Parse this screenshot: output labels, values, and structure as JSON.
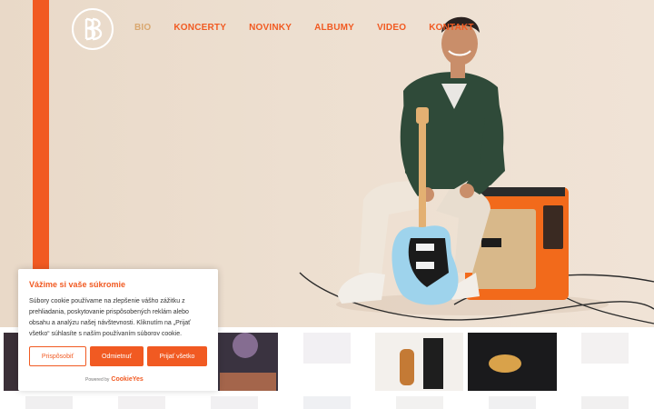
{
  "nav": {
    "items": [
      "BIO",
      "KONCERTY",
      "NOVINKY",
      "ALBUMY",
      "VIDEO",
      "KONTAKT"
    ],
    "active": "BIO"
  },
  "logo": {
    "icon": "bb-monogram-logo"
  },
  "colors": {
    "accent": "#f15a22",
    "nav_active": "#d9a870",
    "hero_bg": "#ecddce"
  },
  "cookie": {
    "title": "Vážime si vaše súkromie",
    "text": "Súbory cookie používame na zlepšenie vášho zážitku z prehliadania, poskytovanie prispôsobených reklám alebo obsahu a analýzu našej návštevnosti. Kliknutím na „Prijať všetko“ súhlasíte s naším používaním súborov cookie.",
    "customize_label": "Prispôsobiť",
    "reject_label": "Odmietnuť",
    "accept_label": "Prijať všetko",
    "powered_label": "Powered by",
    "powered_brand": "CookieYes"
  }
}
